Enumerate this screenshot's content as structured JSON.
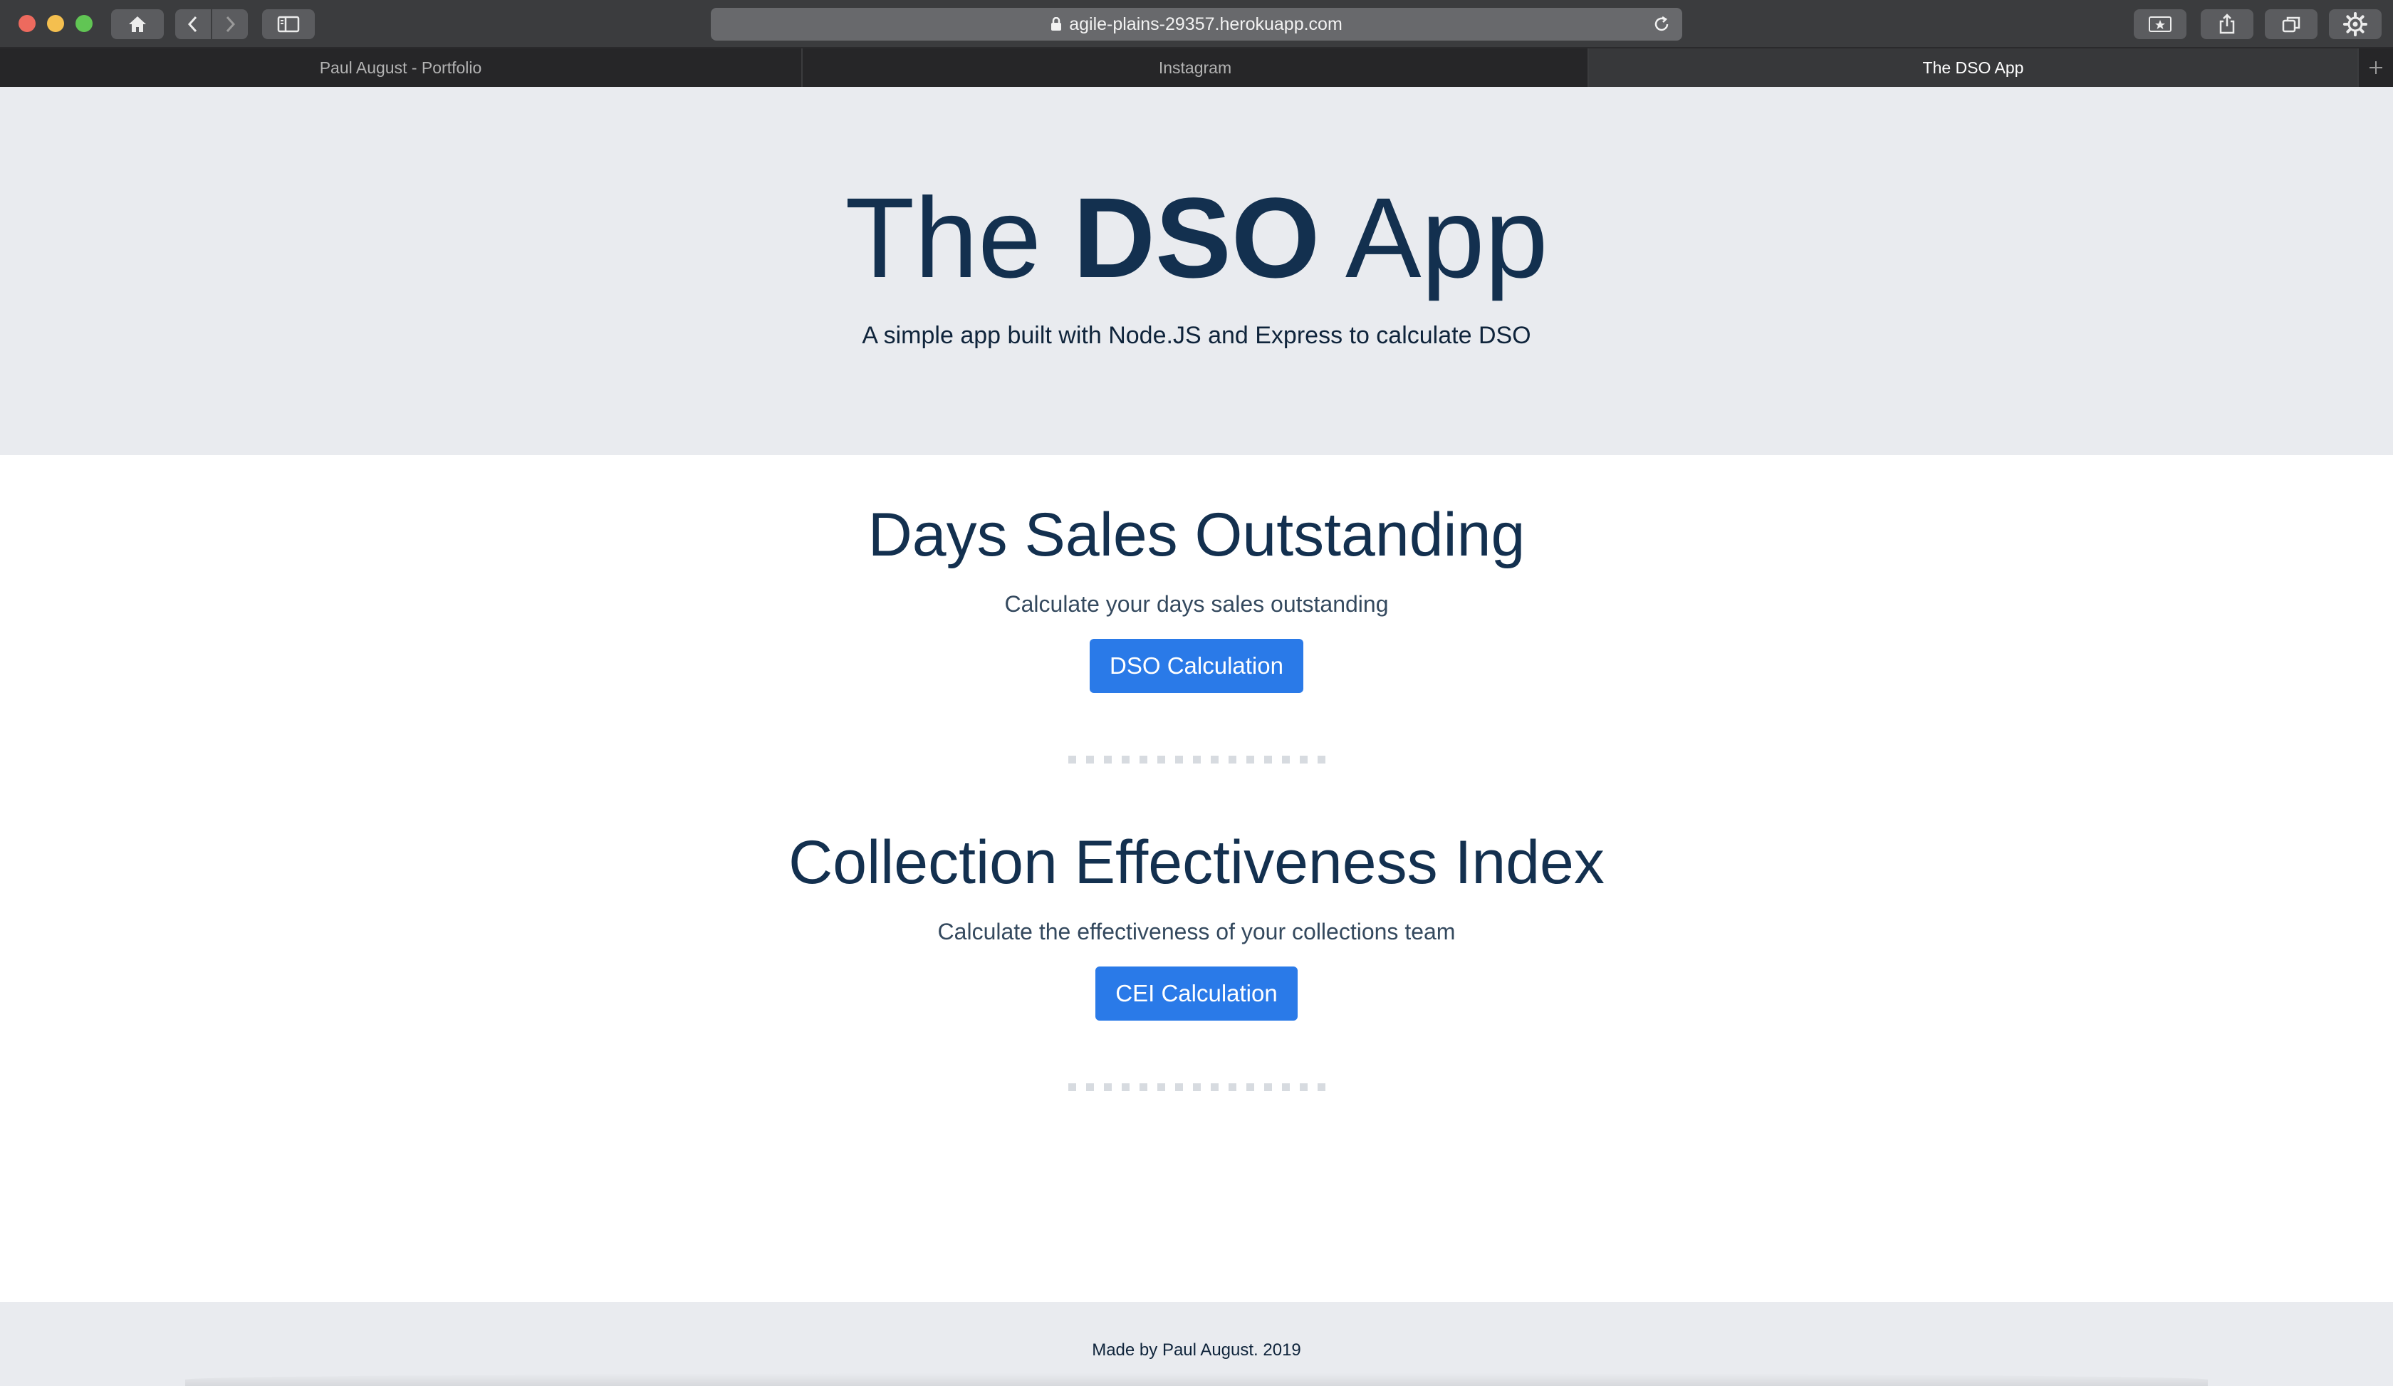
{
  "browser": {
    "url": "agile-plains-29357.herokuapp.com",
    "tabs": [
      {
        "label": "Paul August - Portfolio",
        "active": false
      },
      {
        "label": "Instagram",
        "active": false
      },
      {
        "label": "The DSO App",
        "active": true
      }
    ]
  },
  "hero": {
    "title_prefix": "The",
    "title_bold": "DSO",
    "title_suffix": "App",
    "subtitle": "A simple app built with Node.JS and Express to calculate DSO"
  },
  "sections": [
    {
      "title": "Days Sales Outstanding",
      "description": "Calculate your days sales outstanding",
      "button_label": "DSO Calculation"
    },
    {
      "title": "Collection Effectiveness Index",
      "description": "Calculate the effectiveness of your collections team",
      "button_label": "CEI Calculation"
    }
  ],
  "footer": {
    "text": "Made by Paul August. 2019"
  },
  "colors": {
    "accent": "#2a7ae8",
    "heading": "#13304f",
    "hero_background": "#e9ebef"
  }
}
